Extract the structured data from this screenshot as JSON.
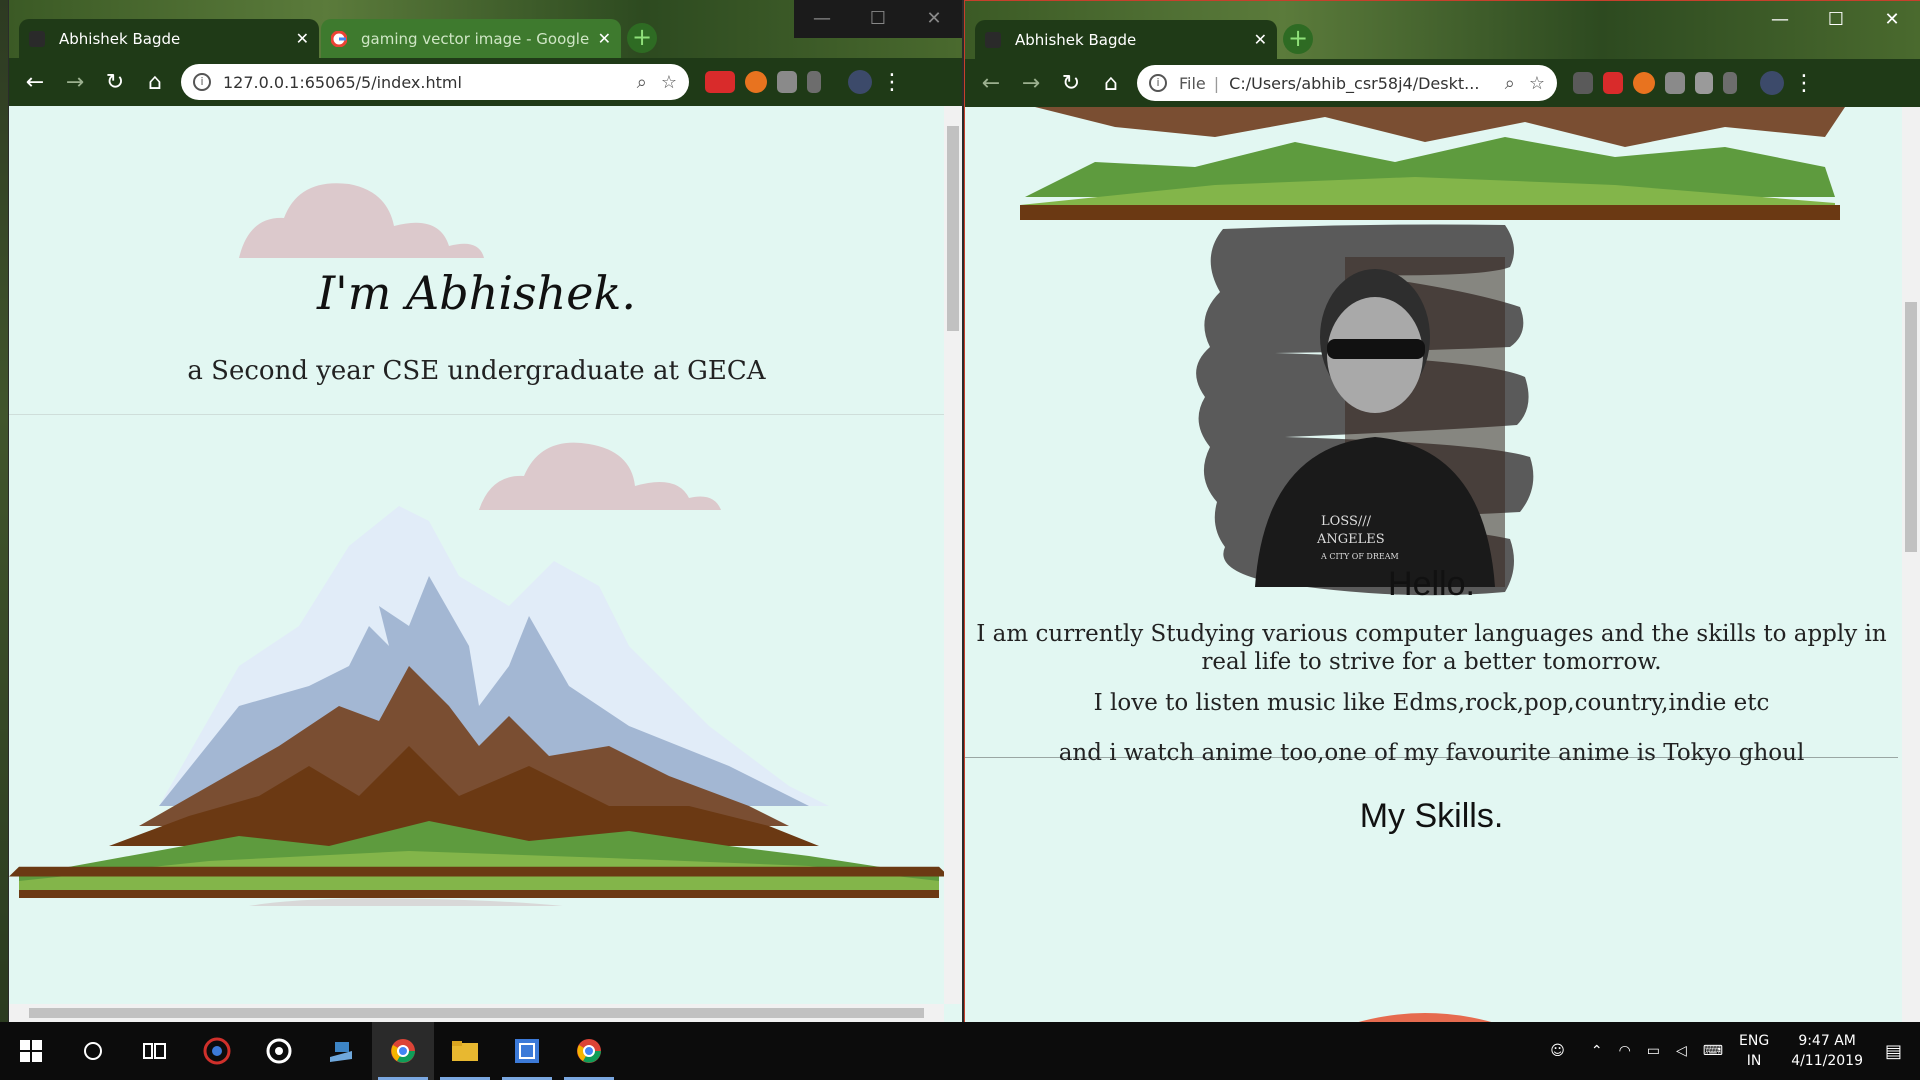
{
  "left": {
    "tabs": [
      {
        "title": "Abhishek Bagde",
        "active": true
      },
      {
        "title": "gaming vector image - Google S",
        "active": false
      }
    ],
    "url": "127.0.0.1:65065/5/index.html",
    "page": {
      "title": "I'm Abhishek.",
      "subtitle": "a Second year CSE undergraduate at GECA"
    }
  },
  "right": {
    "tabs": [
      {
        "title": "Abhishek Bagde",
        "active": true
      }
    ],
    "url_scheme": "File",
    "url": "C:/Users/abhib_csr58j4/Deskt...",
    "page": {
      "hello": "Hello.",
      "para1": "I am currently Studying various computer languages and the skills to apply in real life to strive for a better tomorrow.",
      "para2": "I love to listen music like Edms,rock,pop,country,indie etc",
      "para3": "and i watch anime too,one of my favourite anime is Tokyo ghoul",
      "skills_heading": "My Skills.",
      "shirt_line1": "LOSS///",
      "shirt_line2": "ANGELES",
      "shirt_line3": "A CITY OF DREAM"
    }
  },
  "taskbar": {
    "lang_top": "ENG",
    "lang_bottom": "IN",
    "time": "9:47 AM",
    "date": "4/11/2019"
  },
  "icons": {
    "back": "back-arrow-icon",
    "forward": "forward-arrow-icon",
    "reload": "reload-icon",
    "home": "home-icon",
    "zoom": "zoom-icon",
    "star": "star-icon",
    "menu": "kebab-menu-icon"
  },
  "colors": {
    "page_bg": "#e2f7f2",
    "browser_frame": "#1f3a17",
    "cloud": "#dcc9cc",
    "snow": "#e1ecf8",
    "rock_blue": "#a3b7d3",
    "brown": "#7a4e32",
    "dark_brown": "#6b3913",
    "grass": "#5e9b3e",
    "light_grass": "#83b54a"
  }
}
